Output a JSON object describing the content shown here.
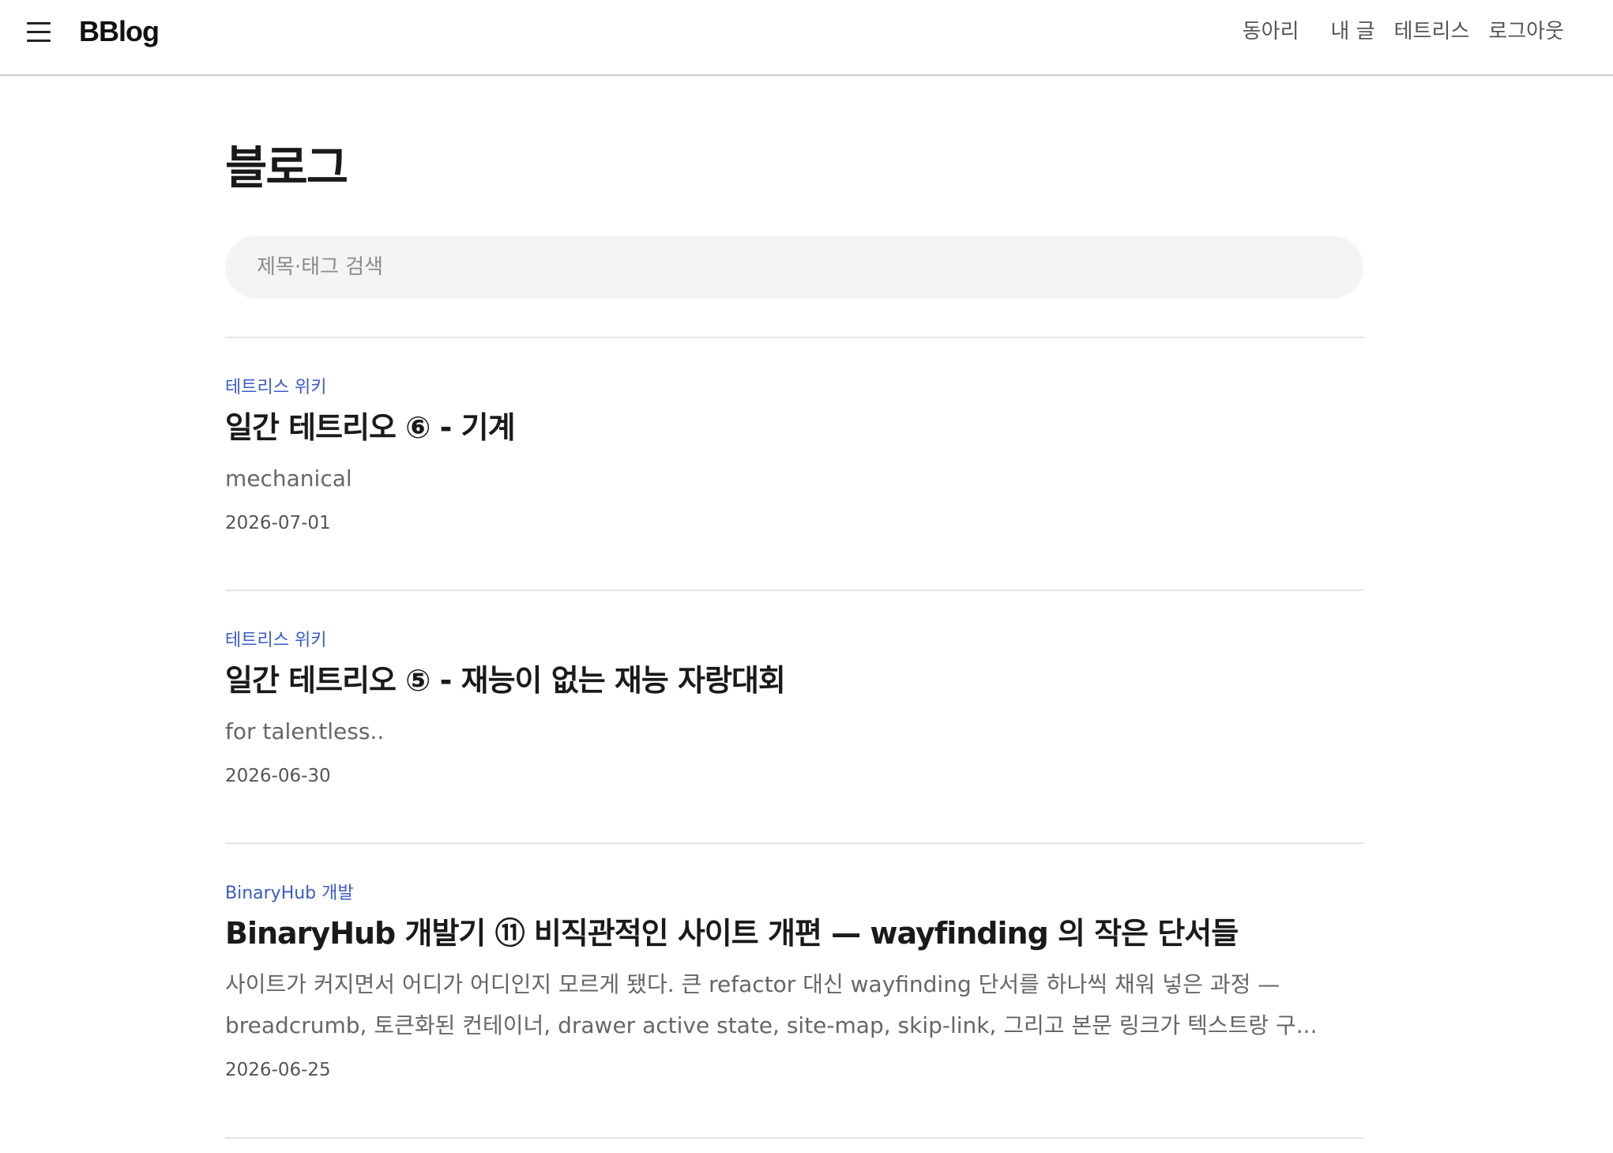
{
  "header": {
    "brand": "BBlog",
    "menu_icon": "hamburger-menu-icon",
    "nav": [
      "동아리",
      "내 글",
      "테트리스",
      "로그아웃"
    ]
  },
  "page": {
    "title": "블로그",
    "search_placeholder": "제목·태그 검색"
  },
  "posts": [
    {
      "category": "테트리스 위키",
      "title": "일간 테트리오 ⑥ - 기계",
      "excerpt": "mechanical",
      "date": "2026-07-01"
    },
    {
      "category": "테트리스 위키",
      "title": "일간 테트리오 ⑤ - 재능이 없는 재능 자랑대회",
      "excerpt": "for talentless..",
      "date": "2026-06-30"
    },
    {
      "category": "BinaryHub 개발",
      "title": "BinaryHub 개발기 ⑪ 비직관적인 사이트 개편 — wayfinding 의 작은 단서들",
      "excerpt": "사이트가 커지면서 어디가 어디인지 모르게 됐다. 큰 refactor 대신 wayfinding 단서를 하나씩 채워 넣은 과정 — breadcrumb, 토큰화된 컨테이너, drawer active state, site-map, skip-link, 그리고 본문 링크가 텍스트랑 구...",
      "date": "2026-06-25"
    }
  ],
  "colors": {
    "category_link": "#3b5bc7",
    "search_bg": "#f3f4f6",
    "divider": "#e4e4e4"
  }
}
